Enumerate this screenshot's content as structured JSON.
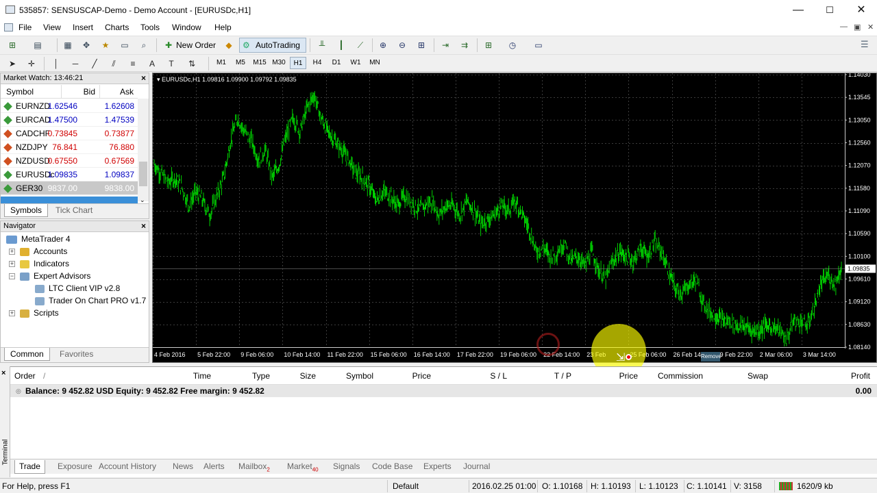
{
  "window": {
    "title": "535857: SENSUSCAP-Demo - Demo Account - [EURUSDc,H1]",
    "minimize": "—",
    "maximize": "☐",
    "close": "✕"
  },
  "menu": [
    "File",
    "View",
    "Insert",
    "Charts",
    "Tools",
    "Window",
    "Help"
  ],
  "toolbar": {
    "new_order": "New Order",
    "autotrading": "AutoTrading",
    "timeframes": [
      "M1",
      "M5",
      "M15",
      "M30",
      "H1",
      "H4",
      "D1",
      "W1",
      "MN"
    ],
    "active_timeframe": "H1"
  },
  "market_watch": {
    "title": "Market Watch: 13:46:21",
    "headers": {
      "symbol": "Symbol",
      "bid": "Bid",
      "ask": "Ask"
    },
    "rows": [
      {
        "symbol": "EURNZD",
        "bid": "1.62546",
        "ask": "1.62608",
        "dir": "up"
      },
      {
        "symbol": "EURCAD",
        "bid": "1.47500",
        "ask": "1.47539",
        "dir": "up"
      },
      {
        "symbol": "CADCHF",
        "bid": "0.73845",
        "ask": "0.73877",
        "dir": "down"
      },
      {
        "symbol": "NZDJPY",
        "bid": "76.841",
        "ask": "76.880",
        "dir": "down"
      },
      {
        "symbol": "NZDUSD",
        "bid": "0.67550",
        "ask": "0.67569",
        "dir": "down"
      },
      {
        "symbol": "EURUSDc",
        "bid": "1.09835",
        "ask": "1.09837",
        "dir": "up"
      },
      {
        "symbol": "GER30",
        "bid": "9837.00",
        "ask": "9838.00",
        "dir": "up"
      }
    ],
    "tabs": [
      "Symbols",
      "Tick Chart"
    ]
  },
  "navigator": {
    "title": "Navigator",
    "items": [
      "MetaTrader 4",
      "Accounts",
      "Indicators",
      "Expert Advisors",
      "LTC Client VIP v2.8",
      "Trader On Chart PRO v1.7",
      "Scripts"
    ],
    "tabs": [
      "Common",
      "Favorites"
    ]
  },
  "chart": {
    "header": "EURUSDc,H1  1.09816 1.09900 1.09792 1.09835",
    "current_price": "1.09835",
    "remove_label": "Remove"
  },
  "chart_data": {
    "type": "line",
    "title": "EURUSDc,H1",
    "price_levels": [
      1.1403,
      1.137,
      1.1338,
      1.1305,
      1.1273,
      1.124,
      1.1208,
      1.1175,
      1.1143,
      1.111,
      1.1078,
      1.1045,
      1.1013,
      1.098,
      1.0948,
      1.0915,
      1.0883,
      1.085,
      1.0818
    ],
    "price_labels": [
      "1.14030",
      "1.13545",
      "1.13050",
      "1.12560",
      "1.12070",
      "1.11580",
      "1.11090",
      "1.10590",
      "1.10100",
      "1.09610",
      "1.09120",
      "1.08630",
      "1.08140"
    ],
    "date_labels": [
      "4 Feb 2016",
      "5 Feb 22:00",
      "9 Feb 06:00",
      "10 Feb 14:00",
      "11 Feb 22:00",
      "15 Feb 06:00",
      "16 Feb 14:00",
      "17 Feb 22:00",
      "19 Feb 06:00",
      "22 Feb 14:00",
      "23 Feb",
      "25 Feb 06:00",
      "26 Feb 14:00",
      "29 Feb 22:00",
      "2 Mar 06:00",
      "3 Mar 14:00"
    ],
    "ylim": [
      1.0814,
      1.1403
    ],
    "y": [
      1.121,
      1.119,
      1.117,
      1.118,
      1.116,
      1.112,
      1.115,
      1.113,
      1.11,
      1.114,
      1.118,
      1.126,
      1.131,
      1.128,
      1.126,
      1.122,
      1.124,
      1.118,
      1.121,
      1.127,
      1.131,
      1.128,
      1.133,
      1.136,
      1.131,
      1.128,
      1.126,
      1.124,
      1.122,
      1.119,
      1.118,
      1.116,
      1.113,
      1.115,
      1.114,
      1.112,
      1.114,
      1.113,
      1.111,
      1.112,
      1.113,
      1.11,
      1.112,
      1.112,
      1.11,
      1.113,
      1.111,
      1.108,
      1.109,
      1.11,
      1.112,
      1.111,
      1.113,
      1.11,
      1.107,
      1.102,
      1.103,
      1.101,
      1.102,
      1.104,
      1.1,
      1.101,
      1.099,
      1.102,
      1.098,
      1.096,
      1.1,
      1.102,
      1.101,
      1.1,
      1.103,
      1.101,
      1.104,
      1.102,
      1.098,
      1.094,
      1.093,
      1.095,
      1.096,
      1.091,
      1.089,
      1.088,
      1.087,
      1.087,
      1.086,
      1.086,
      1.085,
      1.085,
      1.086,
      1.086,
      1.085,
      1.083,
      1.087,
      1.087,
      1.086,
      1.09,
      1.095,
      1.097,
      1.095,
      1.099
    ]
  },
  "terminal": {
    "headers": [
      "Order",
      "Time",
      "Type",
      "Size",
      "Symbol",
      "Price",
      "S / L",
      "T / P",
      "Price",
      "Commission",
      "Swap",
      "Profit"
    ],
    "balance": "Balance: 9 452.82 USD  Equity: 9 452.82  Free margin: 9 452.82",
    "profit": "0.00",
    "tabs": [
      {
        "label": "Trade"
      },
      {
        "label": "Exposure"
      },
      {
        "label": "Account History"
      },
      {
        "label": "News"
      },
      {
        "label": "Alerts"
      },
      {
        "label": "Mailbox",
        "badge": "2"
      },
      {
        "label": "Market",
        "badge": "40"
      },
      {
        "label": "Signals"
      },
      {
        "label": "Code Base"
      },
      {
        "label": "Experts"
      },
      {
        "label": "Journal"
      }
    ],
    "side_label": "Terminal"
  },
  "status": {
    "help": "For Help, press F1",
    "profile": "Default",
    "time": "2016.02.25 01:00",
    "open": "O: 1.10168",
    "high": "H: 1.10193",
    "low": "L: 1.10123",
    "close": "C: 1.10141",
    "volume": "V: 3158",
    "traffic": "1620/9 kb"
  },
  "colors": {
    "bull": "#00d000",
    "bid_up": "#0000c0",
    "bid_down": "#d00000"
  }
}
